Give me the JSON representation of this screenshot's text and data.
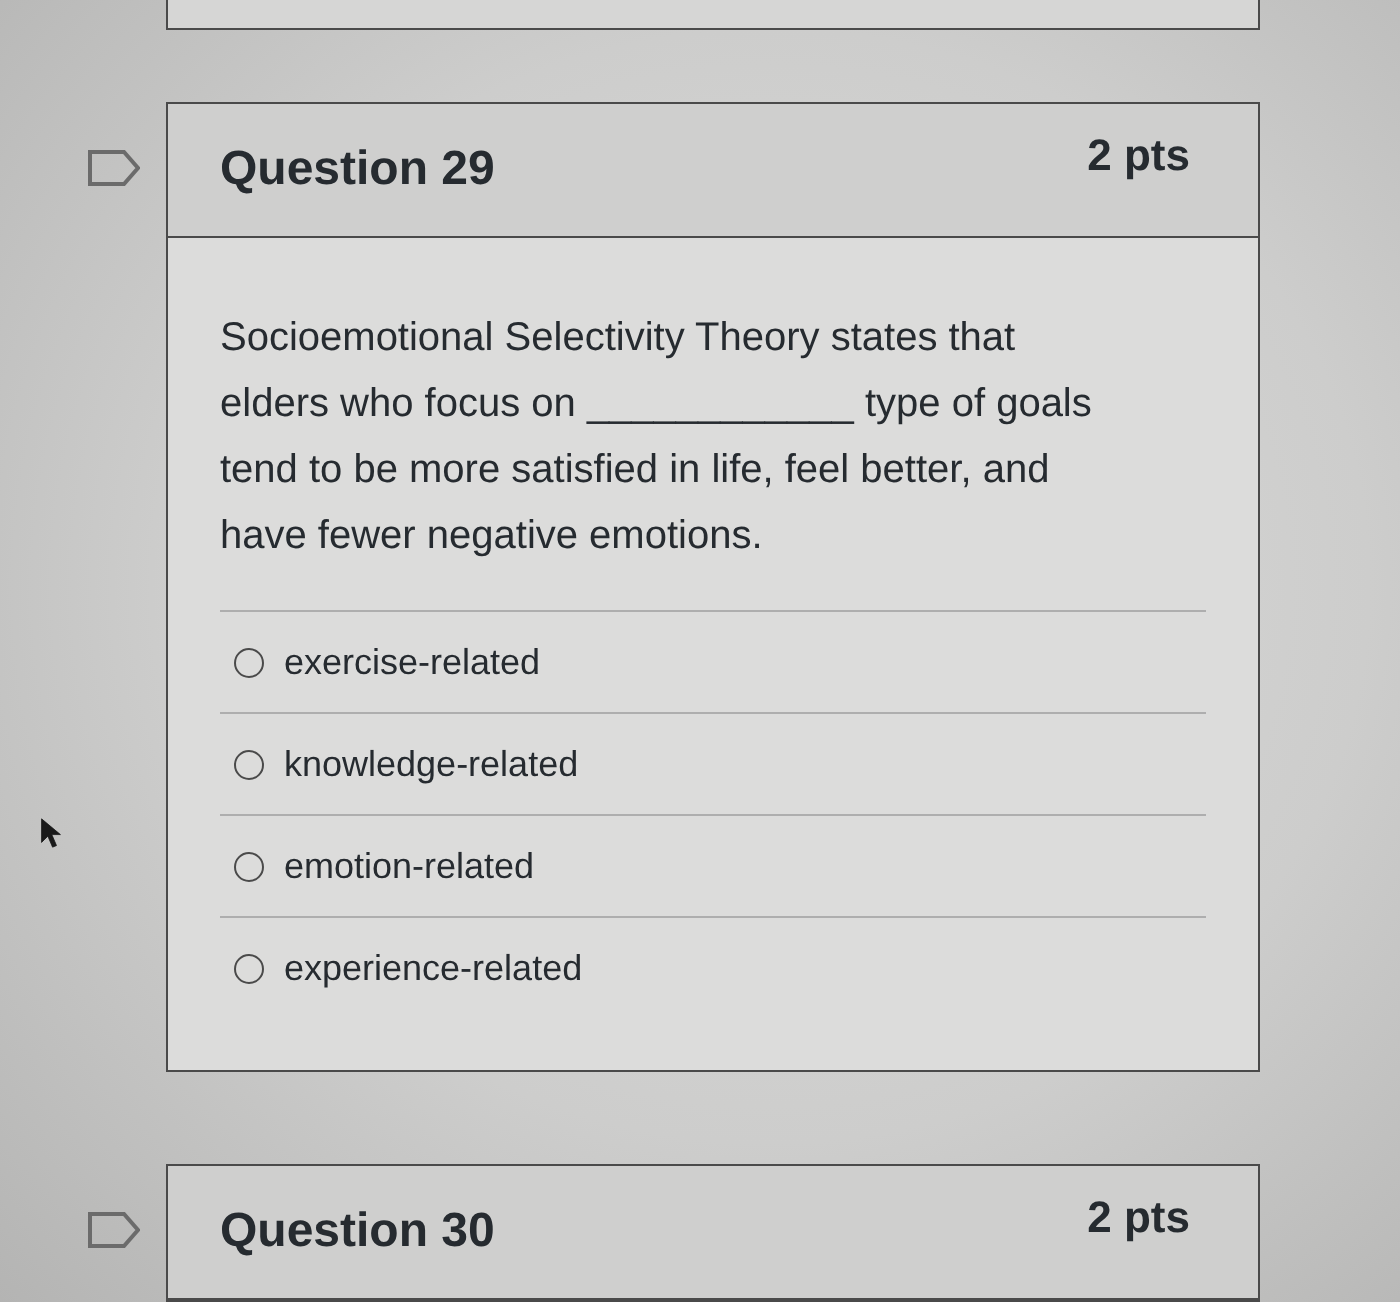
{
  "questions": [
    {
      "flagged": false,
      "title": "Question 29",
      "points": "2 pts",
      "text": "Socioemotional Selectivity Theory states that elders who focus on ____________ type of goals tend to be more satisfied in life, feel better, and have fewer negative emotions.",
      "answers": [
        {
          "label": "exercise-related",
          "selected": false
        },
        {
          "label": "knowledge-related",
          "selected": false
        },
        {
          "label": "emotion-related",
          "selected": false
        },
        {
          "label": "experience-related",
          "selected": false
        }
      ]
    },
    {
      "flagged": false,
      "title": "Question 30",
      "points": "2 pts"
    }
  ]
}
